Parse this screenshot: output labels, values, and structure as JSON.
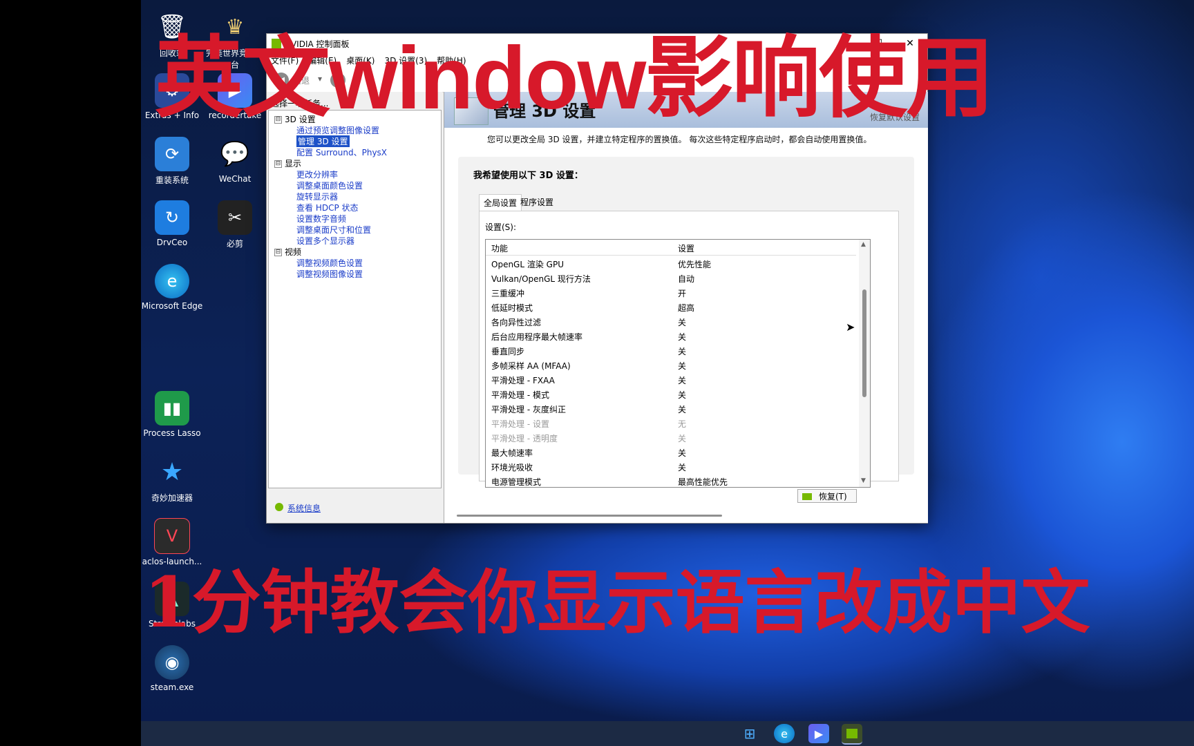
{
  "overlay": {
    "top_text": "英文window影响使用",
    "bottom_text": "1分钟教会你显示语言改成中文"
  },
  "desktop_icons": {
    "col1": [
      "回收站",
      "Extras + Info",
      "重装系统",
      "DrvCeo",
      "Microsoft Edge",
      "Process Lasso",
      "奇妙加速器",
      "aclos-launch...",
      "Streamlabs",
      "steam.exe"
    ],
    "col2": [
      "完美世界竞技平台",
      "recordertake",
      "WeChat",
      "必剪"
    ]
  },
  "window": {
    "title": "NVIDIA 控制面板",
    "controls": {
      "minimize": "—",
      "maximize": "☐",
      "close": "✕"
    },
    "menu": [
      "文件(F)",
      "编辑(E)",
      "桌面(K)",
      "3D 设置(3)",
      "帮助(H)"
    ],
    "back_label": "后退",
    "left": {
      "title": "选择一项任务...",
      "tree": [
        {
          "label": "3D 设置",
          "expander": "⊟"
        },
        {
          "label": "通过预览调整图像设置"
        },
        {
          "label": "管理 3D 设置"
        },
        {
          "label": "配置 Surround、PhysX"
        },
        {
          "label": "显示",
          "expander": "⊟"
        },
        {
          "label": "更改分辨率"
        },
        {
          "label": "调整桌面颜色设置"
        },
        {
          "label": "旋转显示器"
        },
        {
          "label": "查看 HDCP 状态"
        },
        {
          "label": "设置数字音频"
        },
        {
          "label": "调整桌面尺寸和位置"
        },
        {
          "label": "设置多个显示器"
        },
        {
          "label": "视频",
          "expander": "⊟"
        },
        {
          "label": "调整视频颜色设置"
        },
        {
          "label": "调整视频图像设置"
        }
      ],
      "system_info": "系统信息"
    },
    "right": {
      "heading": "管理 3D 设置",
      "restore_defaults": "恢复默认设置",
      "description": "您可以更改全局 3D 设置，并建立特定程序的置换值。 每次这些特定程序启动时，都会自动使用置换值。",
      "panel_title": "我希望使用以下 3D 设置：",
      "tabs": [
        "全局设置",
        "程序设置"
      ],
      "settings_label": "设置(S):",
      "columns": [
        "功能",
        "设置"
      ],
      "rows": [
        {
          "feature": "OpenGL 渲染 GPU",
          "value": "优先性能",
          "disabled": false
        },
        {
          "feature": "Vulkan/OpenGL 现行方法",
          "value": "自动",
          "disabled": false
        },
        {
          "feature": "三重缓冲",
          "value": "开",
          "disabled": false
        },
        {
          "feature": "低延时模式",
          "value": "超高",
          "disabled": false
        },
        {
          "feature": "各向异性过滤",
          "value": "关",
          "disabled": false
        },
        {
          "feature": "后台应用程序最大帧速率",
          "value": "关",
          "disabled": false
        },
        {
          "feature": "垂直同步",
          "value": "关",
          "disabled": false
        },
        {
          "feature": "多帧采样 AA (MFAA)",
          "value": "关",
          "disabled": false
        },
        {
          "feature": "平滑处理 - FXAA",
          "value": "关",
          "disabled": false
        },
        {
          "feature": "平滑处理 - 模式",
          "value": "关",
          "disabled": false
        },
        {
          "feature": "平滑处理 - 灰度纠正",
          "value": "关",
          "disabled": false
        },
        {
          "feature": "平滑处理 - 设置",
          "value": "无",
          "disabled": true
        },
        {
          "feature": "平滑处理 - 透明度",
          "value": "关",
          "disabled": true
        },
        {
          "feature": "最大帧速率",
          "value": "关",
          "disabled": false
        },
        {
          "feature": "环境光吸收",
          "value": "关",
          "disabled": false
        },
        {
          "feature": "电源管理模式",
          "value": "最高性能优先",
          "disabled": false
        }
      ],
      "restore_button": "恢复(T)"
    }
  },
  "colors": {
    "overlay_red": "#d7192a",
    "nvidia_green": "#76b900",
    "selection_blue": "#1e52c8"
  }
}
